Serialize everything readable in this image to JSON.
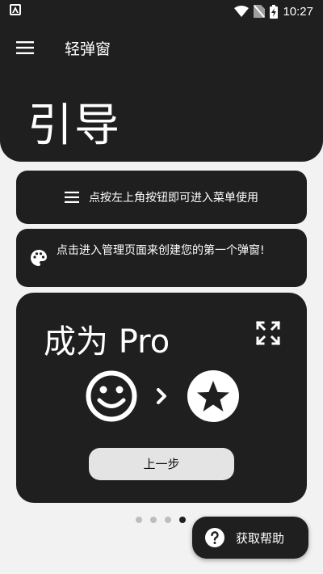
{
  "status_bar": {
    "time": "10:27"
  },
  "app_bar": {
    "title": "轻弹窗"
  },
  "hero": {
    "title": "引导"
  },
  "cards": {
    "hint": "点按左上角按钮即可进入菜单使用",
    "tip": "点击进入管理页面来创建您的第一个弹窗!"
  },
  "pro": {
    "title": "成为 Pro",
    "prev_label": "上一步"
  },
  "pager": {
    "total": 4,
    "active": 4
  },
  "help": {
    "label": "获取帮助"
  },
  "colors": {
    "surface": "#1f1f1f",
    "background": "#f2f2f2",
    "button": "#e4e4e4",
    "dot_inactive": "#bdbdbd"
  }
}
